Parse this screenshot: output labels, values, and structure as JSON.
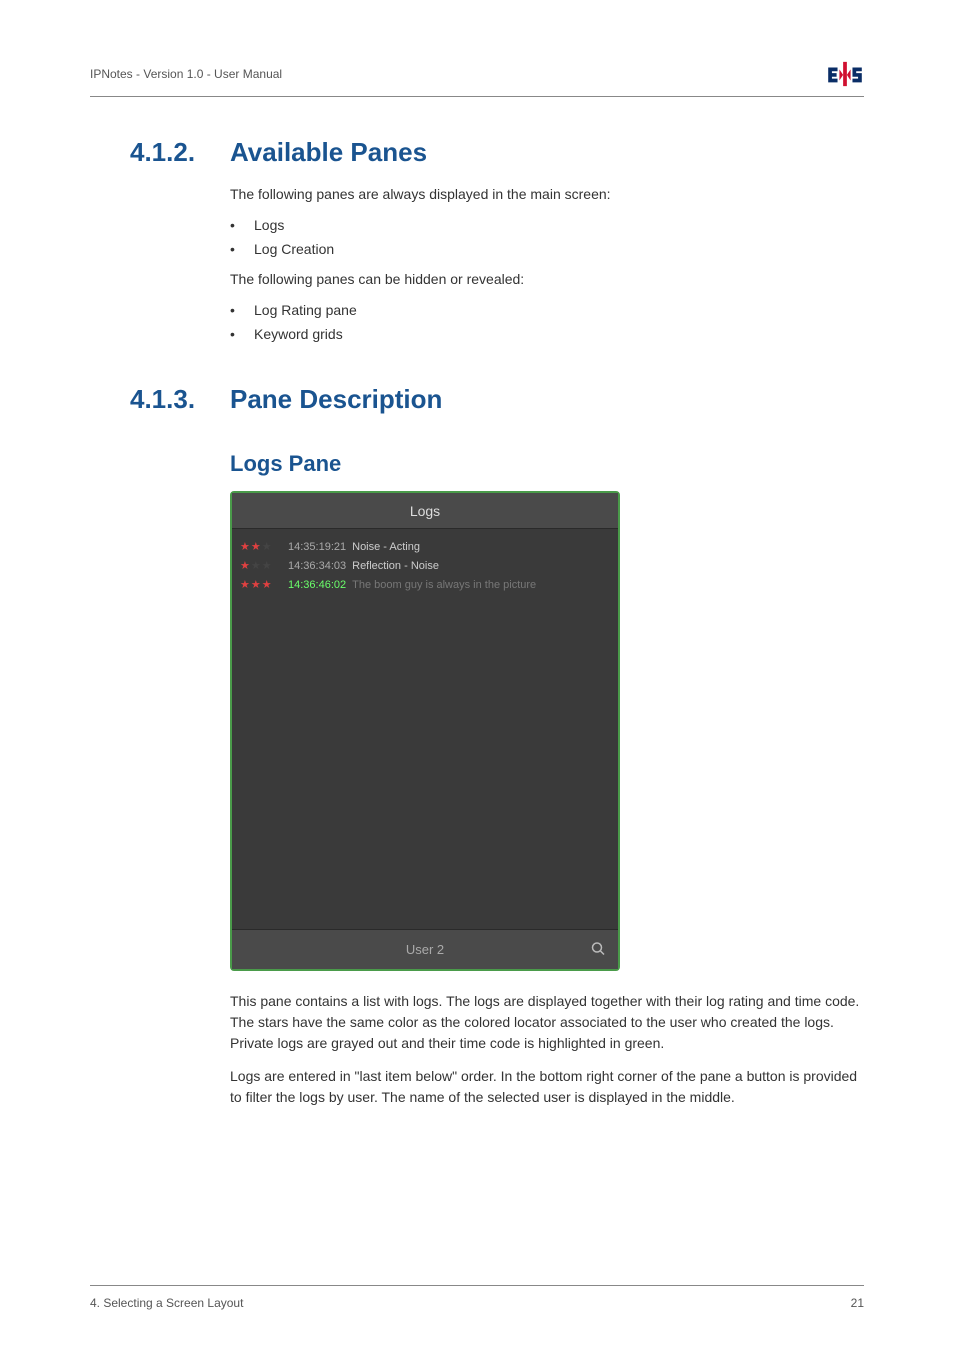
{
  "header": {
    "doc_title": "IPNotes - Version 1.0 - User Manual"
  },
  "section1": {
    "number": "4.1.2.",
    "title": "Available Panes",
    "intro": "The following panes are always displayed in the main screen:",
    "bullets1": [
      "Logs",
      "Log Creation"
    ],
    "intro2": "The following panes can be hidden or revealed:",
    "bullets2": [
      "Log Rating pane",
      "Keyword grids"
    ]
  },
  "section2": {
    "number": "4.1.3.",
    "title": "Pane Description",
    "subheading": "Logs Pane"
  },
  "logs_pane": {
    "title": "Logs",
    "rows": [
      {
        "stars": 2,
        "tc": "14:35:19:21",
        "text": "Noise - Acting",
        "private": false
      },
      {
        "stars": 1,
        "tc": "14:36:34:03",
        "text": "Reflection - Noise",
        "private": false
      },
      {
        "stars": 3,
        "tc": "14:36:46:02",
        "text": "The boom guy is always in the picture",
        "private": true
      }
    ],
    "footer_user": "User 2"
  },
  "body": {
    "para1": "This pane contains a list with logs. The logs are displayed together with their log rating and time code. The stars have the same color as the colored locator associated to the user who created the logs. Private logs are grayed out and their time code is highlighted in green.",
    "para2": "Logs are entered in \"last item below\" order. In the bottom right corner of the pane a button is provided to filter the logs by user. The name of the selected user is displayed in the middle."
  },
  "footer": {
    "chapter": "4. Selecting a Screen Layout",
    "page": "21"
  }
}
